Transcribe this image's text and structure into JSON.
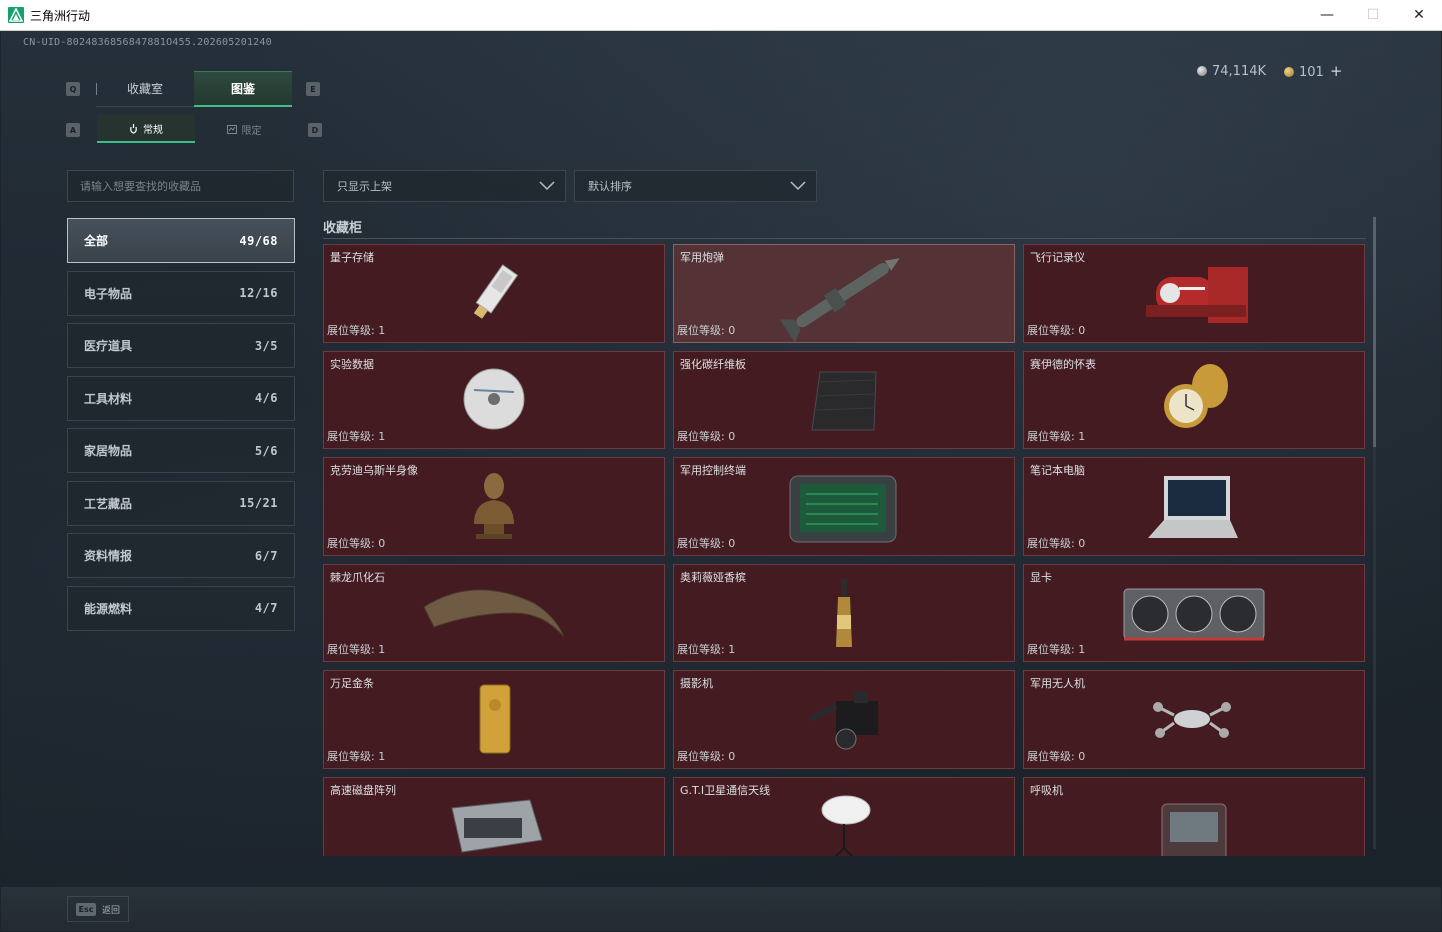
{
  "window": {
    "title": "三角洲行动",
    "minimize": "—",
    "maximize": "☐",
    "close": "✕"
  },
  "uid": "CN-UID-8024836856847881O455.202605201240",
  "currency": {
    "silver": "74,114K",
    "gold": "101",
    "plus": "+"
  },
  "keys": {
    "q": "Q",
    "e": "E",
    "a": "A",
    "d": "D"
  },
  "tabs": [
    {
      "label": "收藏室"
    },
    {
      "label": "图鉴"
    }
  ],
  "subtabs": [
    {
      "label": "常规"
    },
    {
      "label": "限定"
    }
  ],
  "search": {
    "placeholder": "请输入想要查找的收藏品"
  },
  "categories": [
    {
      "label": "全部",
      "count": "49/68"
    },
    {
      "label": "电子物品",
      "count": "12/16"
    },
    {
      "label": "医疗道具",
      "count": "3/5"
    },
    {
      "label": "工具材料",
      "count": "4/6"
    },
    {
      "label": "家居物品",
      "count": "5/6"
    },
    {
      "label": "工艺藏品",
      "count": "15/21"
    },
    {
      "label": "资料情报",
      "count": "6/7"
    },
    {
      "label": "能源燃料",
      "count": "4/7"
    }
  ],
  "filters": {
    "show": "只显示上架",
    "sort": "默认排序"
  },
  "section_title": "收藏柜",
  "items": [
    {
      "name": "量子存储",
      "level": "展位等级:  1",
      "icon": "usb-drive-icon"
    },
    {
      "name": "军用炮弹",
      "level": "展位等级:  0",
      "icon": "missile-icon"
    },
    {
      "name": "飞行记录仪",
      "level": "展位等级:  0",
      "icon": "flight-recorder-icon"
    },
    {
      "name": "实验数据",
      "level": "展位等级:  1",
      "icon": "disc-icon"
    },
    {
      "name": "强化碳纤维板",
      "level": "展位等级:  0",
      "icon": "carbon-plate-icon"
    },
    {
      "name": "赛伊德的怀表",
      "level": "展位等级:  1",
      "icon": "pocket-watch-icon"
    },
    {
      "name": "克劳迪乌斯半身像",
      "level": "展位等级:  0",
      "icon": "bust-icon"
    },
    {
      "name": "军用控制终端",
      "level": "展位等级:  0",
      "icon": "control-terminal-icon"
    },
    {
      "name": "笔记本电脑",
      "level": "展位等级:  0",
      "icon": "laptop-icon"
    },
    {
      "name": "棘龙爪化石",
      "level": "展位等级:  1",
      "icon": "claw-fossil-icon"
    },
    {
      "name": "奥莉薇娅香槟",
      "level": "展位等级:  1",
      "icon": "champagne-icon"
    },
    {
      "name": "显卡",
      "level": "展位等级:  1",
      "icon": "graphics-card-icon"
    },
    {
      "name": "万足金条",
      "level": "展位等级:  1",
      "icon": "gold-bar-icon"
    },
    {
      "name": "摄影机",
      "level": "展位等级:  0",
      "icon": "camera-icon"
    },
    {
      "name": "军用无人机",
      "level": "展位等级:  0",
      "icon": "drone-icon"
    },
    {
      "name": "高速磁盘阵列",
      "level": "",
      "icon": "disk-array-icon"
    },
    {
      "name": "G.T.I卫星通信天线",
      "level": "",
      "icon": "satellite-dish-icon"
    },
    {
      "name": "呼吸机",
      "level": "",
      "icon": "ventilator-icon"
    }
  ],
  "esc": {
    "key": "Esc",
    "label": "返回"
  }
}
